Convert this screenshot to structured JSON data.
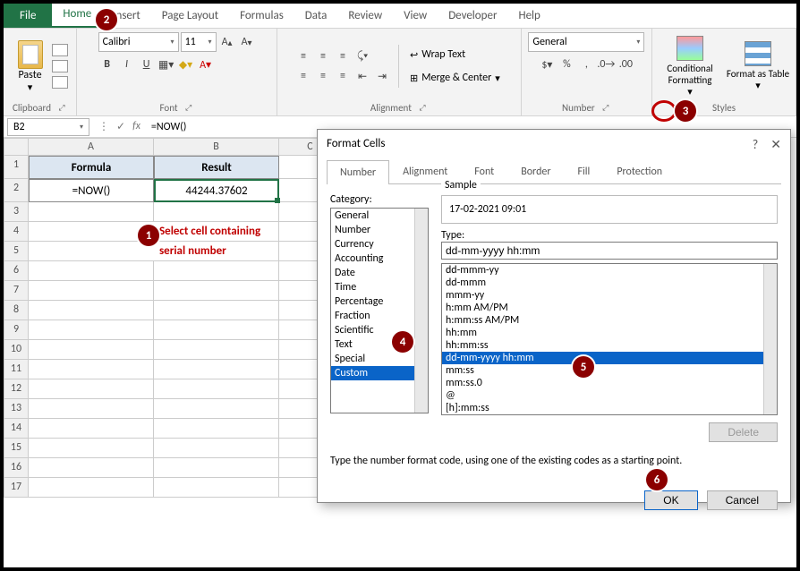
{
  "tabs": [
    "File",
    "Home",
    "Insert",
    "Page Layout",
    "Formulas",
    "Data",
    "Review",
    "View",
    "Developer",
    "Help"
  ],
  "active_tab": "Home",
  "ribbon": {
    "clipboard": {
      "label": "Clipboard",
      "paste": "Paste"
    },
    "font": {
      "label": "Font",
      "name": "Calibri",
      "size": "11",
      "bold": "B",
      "italic": "I",
      "underline": "U"
    },
    "alignment": {
      "label": "Alignment",
      "wrap": "Wrap Text",
      "merge": "Merge & Center"
    },
    "number": {
      "label": "Number",
      "format": "General"
    },
    "styles": {
      "label": "Styles",
      "cond": "Conditional Formatting",
      "table": "Format as Table"
    }
  },
  "fbar": {
    "name": "B2",
    "formula": "=NOW()"
  },
  "grid": {
    "cols": [
      "A",
      "B",
      "C"
    ],
    "rows": [
      "1",
      "2",
      "3",
      "4",
      "5",
      "6",
      "7",
      "8",
      "9",
      "10",
      "11",
      "12",
      "13",
      "14",
      "15",
      "16",
      "17"
    ],
    "a1": "Formula",
    "b1": "Result",
    "a2": "=NOW()",
    "b2": "44244.37602",
    "note1": "Select cell containing",
    "note2": "serial number"
  },
  "dialog": {
    "title": "Format Cells",
    "tabs": [
      "Number",
      "Alignment",
      "Font",
      "Border",
      "Fill",
      "Protection"
    ],
    "active_tab": "Number",
    "category_label": "Category:",
    "categories": [
      "General",
      "Number",
      "Currency",
      "Accounting",
      "Date",
      "Time",
      "Percentage",
      "Fraction",
      "Scientific",
      "Text",
      "Special",
      "Custom"
    ],
    "category_selected": "Custom",
    "sample_label": "Sample",
    "sample": "17-02-2021 09:01",
    "type_label": "Type:",
    "type_value": "dd-mm-yyyy hh:mm",
    "type_list": [
      "dd-mmm-yy",
      "dd-mmm",
      "mmm-yy",
      "h:mm AM/PM",
      "h:mm:ss AM/PM",
      "hh:mm",
      "hh:mm:ss",
      "dd-mm-yyyy hh:mm",
      "mm:ss",
      "mm:ss.0",
      "@",
      "[h]:mm:ss"
    ],
    "type_selected": "dd-mm-yyyy hh:mm",
    "hint": "Type the number format code, using one of the existing codes as a starting point.",
    "delete": "Delete",
    "ok": "OK",
    "cancel": "Cancel"
  },
  "badges": {
    "1": "1",
    "2": "2",
    "3": "3",
    "4": "4",
    "5": "5",
    "6": "6"
  }
}
